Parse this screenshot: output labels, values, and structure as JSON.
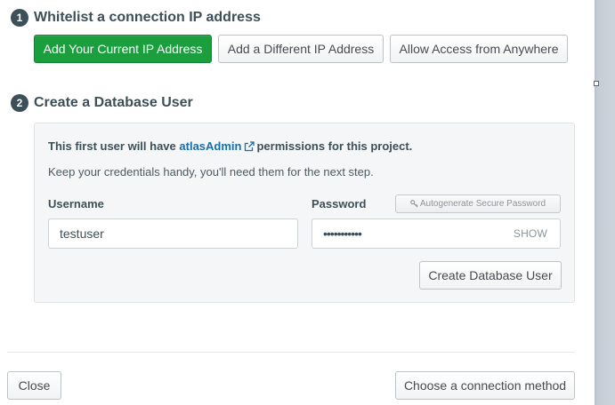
{
  "step1": {
    "number": "1",
    "title": "Whitelist a connection IP address",
    "buttons": {
      "current_ip": "Add Your Current IP Address",
      "different_ip": "Add a Different IP Address",
      "anywhere": "Allow Access from Anywhere"
    }
  },
  "step2": {
    "number": "2",
    "title": "Create a Database User",
    "intro_prefix": "This first user will have",
    "intro_link": "atlasAdmin",
    "intro_suffix": "permissions for this project.",
    "hint": "Keep your credentials handy, you'll need them for the next step.",
    "username": {
      "label": "Username",
      "value": "testuser"
    },
    "password": {
      "label": "Password",
      "value": "•••••••••••",
      "show_label": "SHOW",
      "autogenerate_label": "Autogenerate Secure Password"
    },
    "create_user_label": "Create Database User"
  },
  "footer": {
    "close_label": "Close",
    "next_label": "Choose a connection method"
  },
  "colors": {
    "primary_green": "#1b9e3e",
    "link_blue": "#1a6fa8",
    "text_dark": "#3d4f58",
    "panel_bg": "#f5f6f7"
  },
  "icons": {
    "external_link": "external-link-icon",
    "key": "key-icon"
  }
}
